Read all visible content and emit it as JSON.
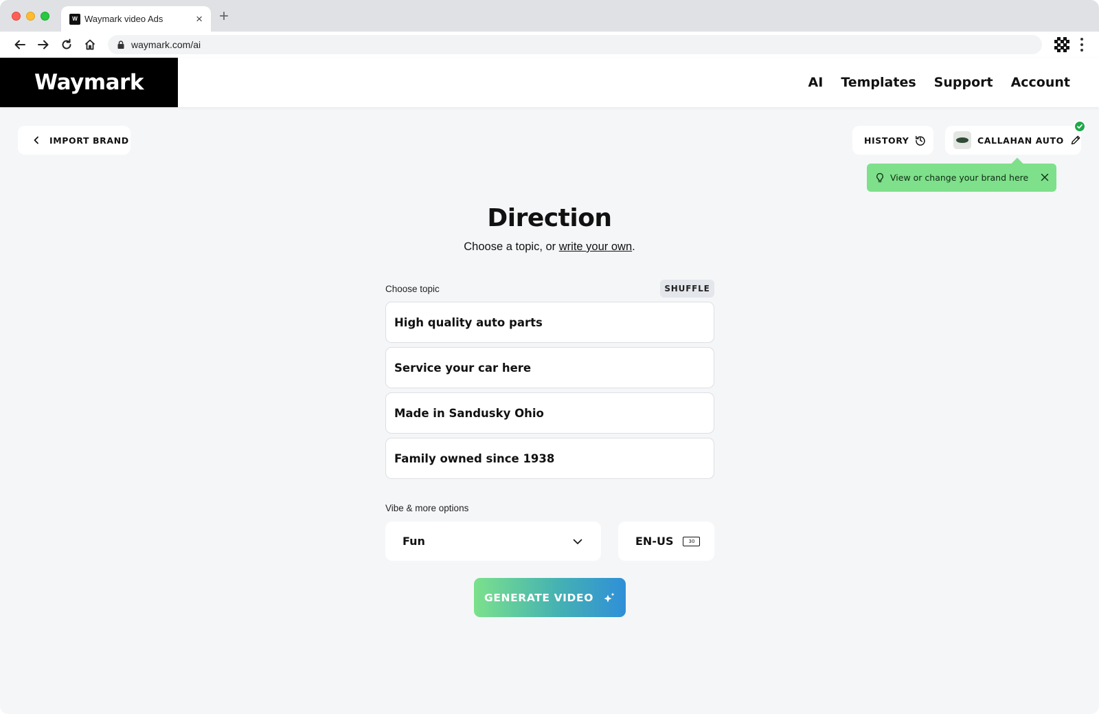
{
  "browser": {
    "tab_title": "Waymark video Ads",
    "favicon_text": "W",
    "url": "waymark.com/ai"
  },
  "header": {
    "logo": "Waymark",
    "nav": [
      "AI",
      "Templates",
      "Support",
      "Account"
    ]
  },
  "toolbar": {
    "import_brand": "IMPORT BRAND",
    "history": "HISTORY",
    "brand_name": "CALLAHAN AUTO"
  },
  "tooltip": {
    "text": "View or change your brand here"
  },
  "main": {
    "title": "Direction",
    "subtitle_prefix": "Choose a topic, or ",
    "subtitle_link": "write your own",
    "subtitle_suffix": ".",
    "choose_topic_label": "Choose topic",
    "shuffle_label": "SHUFFLE",
    "topics": [
      "High quality auto parts",
      "Service your car here",
      "Made in Sandusky Ohio",
      "Family owned since 1938"
    ],
    "vibe_label": "Vibe & more options",
    "vibe_value": "Fun",
    "language": "EN-US",
    "duration": "30",
    "generate_label": "GENERATE VIDEO"
  },
  "colors": {
    "page_bg": "#f5f6f8",
    "tooltip_bg": "#7ee08a",
    "check_badge": "#1ea84a",
    "generate_gradient_start": "#7be18c",
    "generate_gradient_end": "#2f8fd8"
  },
  "icons": {
    "back": "arrow-left-icon",
    "forward": "arrow-right-icon",
    "reload": "reload-icon",
    "home": "home-icon",
    "lock": "lock-icon",
    "history": "history-icon",
    "edit": "pencil-icon",
    "verified": "check-circle-icon",
    "tip": "lightbulb-icon",
    "dismiss": "close-icon",
    "dropdown": "chevron-down-icon",
    "generate": "sparkle-icon"
  }
}
